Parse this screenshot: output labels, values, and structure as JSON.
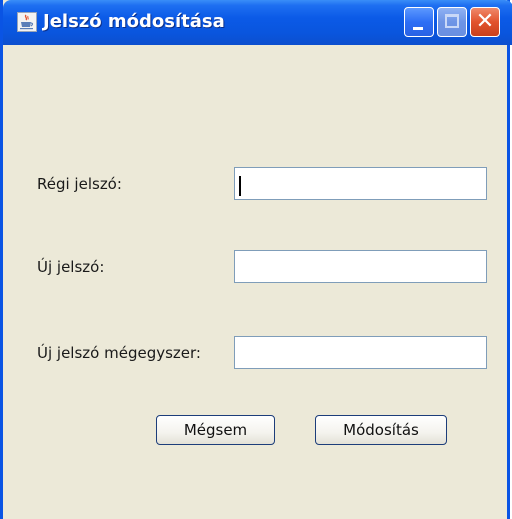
{
  "window": {
    "title": "Jelszó módosítása",
    "close_glyph": "✕"
  },
  "icons": {
    "window_icon": "java-coffee-cup-icon",
    "minimize": "minimize-icon",
    "maximize": "maximize-icon",
    "close": "close-icon"
  },
  "colors": {
    "titlebar": "#0a55dd",
    "body": "#ece9d8",
    "field_border": "#7f9db9",
    "close_button": "#e2532d"
  },
  "form": {
    "old_password_label": "Régi jelszó:",
    "old_password_value": "",
    "new_password_label": "Új jelszó:",
    "new_password_value": "",
    "confirm_password_label": "Új jelszó mégegyszer:",
    "confirm_password_value": ""
  },
  "buttons": {
    "cancel_label": "Mégsem",
    "modify_label": "Módosítás"
  }
}
